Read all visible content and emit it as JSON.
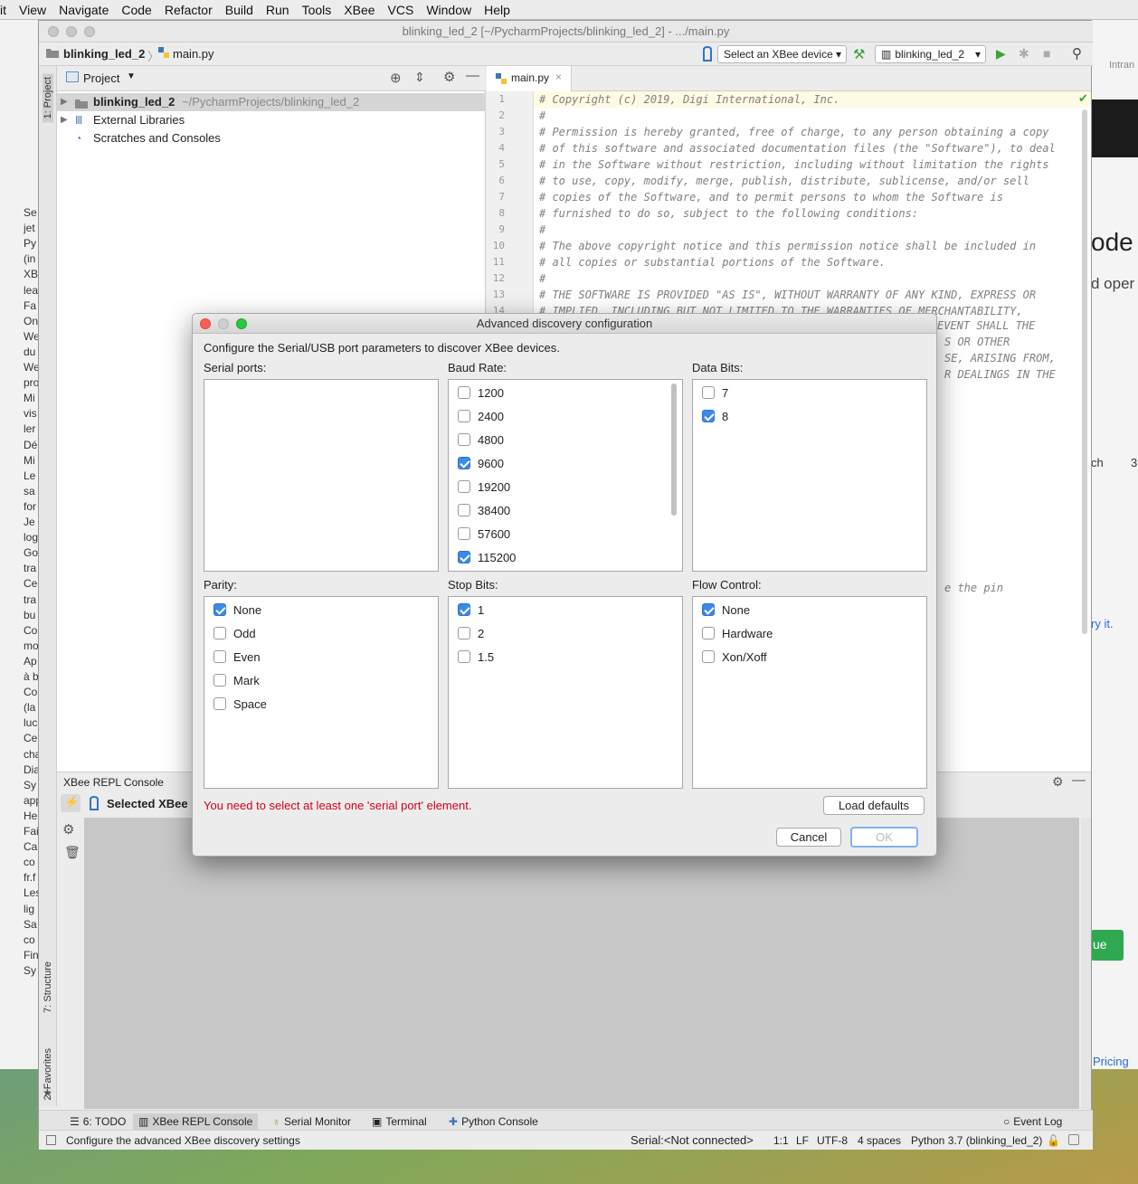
{
  "menubar": [
    "it",
    "View",
    "Navigate",
    "Code",
    "Refactor",
    "Build",
    "Run",
    "Tools",
    "XBee",
    "VCS",
    "Window",
    "Help"
  ],
  "window": {
    "title": "blinking_led_2 [~/PycharmProjects/blinking_led_2] - .../main.py"
  },
  "navbar": {
    "project": "blinking_led_2",
    "file": "main.py",
    "device_select": "Select an XBee device",
    "run_config": "blinking_led_2"
  },
  "left_stripe": {
    "project": "1: Project",
    "structure": "7: Structure",
    "favorites": "2: Favorites"
  },
  "project_panel": {
    "header": "Project",
    "tree": [
      {
        "name": "blinking_led_2",
        "path": "~/PycharmProjects/blinking_led_2"
      },
      {
        "name": "External Libraries"
      },
      {
        "name": "Scratches and Consoles"
      }
    ]
  },
  "editor": {
    "tab": "main.py",
    "lines": [
      {
        "n": "1",
        "text": "# Copyright (c) 2019, Digi International, Inc."
      },
      {
        "n": "2",
        "text": "#"
      },
      {
        "n": "3",
        "text": "# Permission is hereby granted, free of charge, to any person obtaining a copy"
      },
      {
        "n": "4",
        "text": "# of this software and associated documentation files (the \"Software\"), to deal"
      },
      {
        "n": "5",
        "text": "# in the Software without restriction, including without limitation the rights"
      },
      {
        "n": "6",
        "text": "# to use, copy, modify, merge, publish, distribute, sublicense, and/or sell"
      },
      {
        "n": "7",
        "text": "# copies of the Software, and to permit persons to whom the Software is"
      },
      {
        "n": "8",
        "text": "# furnished to do so, subject to the following conditions:"
      },
      {
        "n": "9",
        "text": "#"
      },
      {
        "n": "10",
        "text": "# The above copyright notice and this permission notice shall be included in"
      },
      {
        "n": "11",
        "text": "# all copies or substantial portions of the Software."
      },
      {
        "n": "12",
        "text": "#"
      },
      {
        "n": "13",
        "text": "# THE SOFTWARE IS PROVIDED \"AS IS\", WITHOUT WARRANTY OF ANY KIND, EXPRESS OR"
      },
      {
        "n": "14",
        "text": "# IMPLIED, INCLUDING BUT NOT LIMITED TO THE WARRANTIES OF MERCHANTABILITY,"
      }
    ],
    "peek": [
      "EVENT SHALL THE",
      "S OR OTHER",
      "SE, ARISING FROM,",
      "R DEALINGS IN THE",
      "e the pin"
    ]
  },
  "repl": {
    "title": "XBee REPL Console",
    "selected": "Selected XBee"
  },
  "bottom_tabs": [
    "6: TODO",
    "XBee REPL Console",
    "Serial Monitor",
    "Terminal",
    "Python Console",
    "Event Log"
  ],
  "statusbar": {
    "hint": "Configure the advanced XBee discovery settings",
    "serial": "Serial:<Not connected>",
    "position": "1:1",
    "line_sep": "LF",
    "encoding": "UTF-8",
    "indent": "4 spaces",
    "interpreter": "Python 3.7 (blinking_led_2)"
  },
  "dialog": {
    "title": "Advanced discovery configuration",
    "intro": "Configure the Serial/USB port parameters to discover XBee devices.",
    "serial_ports": {
      "label": "Serial ports:",
      "options": []
    },
    "baud_rate": {
      "label": "Baud Rate:",
      "options": [
        {
          "label": "1200",
          "checked": false
        },
        {
          "label": "2400",
          "checked": false
        },
        {
          "label": "4800",
          "checked": false
        },
        {
          "label": "9600",
          "checked": true
        },
        {
          "label": "19200",
          "checked": false
        },
        {
          "label": "38400",
          "checked": false
        },
        {
          "label": "57600",
          "checked": false
        },
        {
          "label": "115200",
          "checked": true
        }
      ]
    },
    "data_bits": {
      "label": "Data Bits:",
      "options": [
        {
          "label": "7",
          "checked": false
        },
        {
          "label": "8",
          "checked": true
        }
      ]
    },
    "parity": {
      "label": "Parity:",
      "options": [
        {
          "label": "None",
          "checked": true
        },
        {
          "label": "Odd",
          "checked": false
        },
        {
          "label": "Even",
          "checked": false
        },
        {
          "label": "Mark",
          "checked": false
        },
        {
          "label": "Space",
          "checked": false
        }
      ]
    },
    "stop_bits": {
      "label": "Stop Bits:",
      "options": [
        {
          "label": "1",
          "checked": true
        },
        {
          "label": "2",
          "checked": false
        },
        {
          "label": "1.5",
          "checked": false
        }
      ]
    },
    "flow_control": {
      "label": "Flow Control:",
      "options": [
        {
          "label": "None",
          "checked": true
        },
        {
          "label": "Hardware",
          "checked": false
        },
        {
          "label": "Xon/Xoff",
          "checked": false
        }
      ]
    },
    "error": "You need to select at least one 'serial port' element.",
    "load_defaults": "Load defaults",
    "cancel": "Cancel",
    "ok": "OK"
  },
  "background_right": {
    "t1": "ode",
    "t2": "d oper",
    "t3": "ch",
    "t4": "3",
    "t5": "ry it.",
    "t6": "ue",
    "t7": "Pricing",
    "t8": "Intran"
  },
  "background_left": [
    "Se",
    "jet",
    "Py",
    "(in",
    "XB",
    "lea",
    "Fa",
    "On",
    "We",
    "du",
    "We",
    "pro",
    "Mi",
    "vis",
    "ler",
    "Dé",
    "Mi",
    "Le",
    "sa",
    "for",
    "Je",
    "log",
    "Go",
    "tra",
    "Ce",
    "tra",
    "bu",
    "Co",
    "mo",
    "Ap",
    "à b",
    "Co",
    "(la",
    "luc",
    "Ce",
    "cha",
    "Dia",
    "Sy",
    "app",
    "He",
    "Fai",
    "Ca",
    "co",
    "fr.f",
    "Les",
    "lig",
    "Sa",
    "co",
    "Fin",
    "Sy"
  ],
  "colors": {
    "accent": "#3d8ae6",
    "error": "#d0021b",
    "run": "#3aa336"
  }
}
